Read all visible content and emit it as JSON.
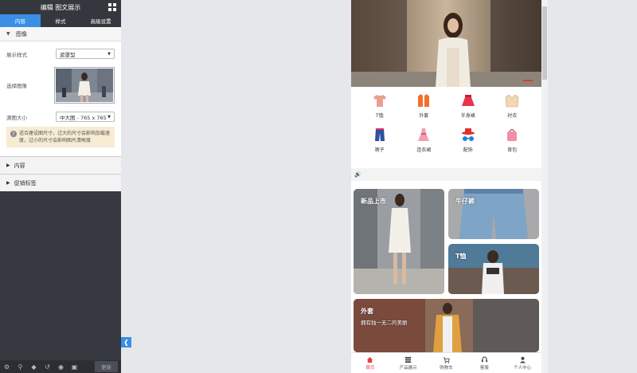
{
  "editor": {
    "title": "编辑 图文展示",
    "tabs": [
      {
        "label": "内容",
        "active": true
      },
      {
        "label": "样式",
        "active": false
      },
      {
        "label": "高级设置",
        "active": false
      }
    ],
    "image_section": {
      "title": "图像",
      "display_style_label": "展示样式",
      "display_style_value": "遮罩型",
      "select_image_label": "选择图像",
      "source_size_label": "源图大小",
      "source_size_value": "中大图 - 765 x 765",
      "notice_text": "适合建设图尺寸，过大的尺寸会影响加载速度，过小的尺寸会影响图片清晰度"
    },
    "collapsed_sections": [
      {
        "title": "内容"
      },
      {
        "title": "促销标签"
      }
    ],
    "footer": {
      "update_label": "更新"
    },
    "accent_color": "#3a8ee6"
  },
  "preview": {
    "categories": [
      {
        "label": "T恤",
        "icon": "tshirt-icon",
        "color": "#e8a090"
      },
      {
        "label": "外套",
        "icon": "jacket-icon",
        "color": "#f07030"
      },
      {
        "label": "半身裙",
        "icon": "skirt-icon",
        "color": "#e8344a"
      },
      {
        "label": "衬衣",
        "icon": "shirt-icon",
        "color": "#f0d8b0"
      },
      {
        "label": "裤子",
        "icon": "pants-icon",
        "color": "#3050a0"
      },
      {
        "label": "连衣裙",
        "icon": "dress-icon",
        "color": "#f0a0b0"
      },
      {
        "label": "配饰",
        "icon": "hat-glasses-icon",
        "color": "#e03030"
      },
      {
        "label": "背包",
        "icon": "bag-icon",
        "color": "#f090a8"
      }
    ],
    "cards": [
      {
        "title": "新品上市",
        "subtitle": ""
      },
      {
        "title": "牛仔裤",
        "subtitle": ""
      },
      {
        "title": "T恤",
        "subtitle": ""
      },
      {
        "title": "外套",
        "subtitle": "拥有独一无二的美丽"
      }
    ],
    "tabbar": [
      {
        "label": "首页",
        "icon": "home-icon",
        "active": true
      },
      {
        "label": "产品展示",
        "icon": "list-icon",
        "active": false
      },
      {
        "label": "购物车",
        "icon": "cart-icon",
        "active": false
      },
      {
        "label": "客服",
        "icon": "headset-icon",
        "active": false
      },
      {
        "label": "个人中心",
        "icon": "user-icon",
        "active": false
      }
    ]
  }
}
